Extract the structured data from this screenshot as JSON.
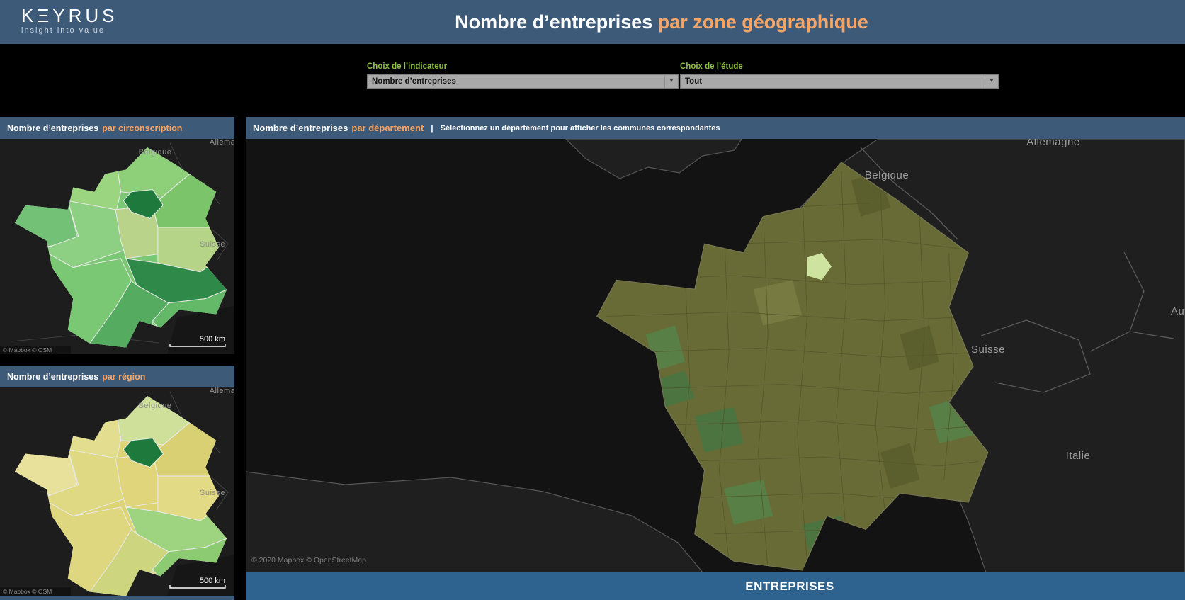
{
  "header": {
    "logo_text": "KΞYRUS",
    "logo_tagline": "insight into value",
    "title_main": "Nombre d’entreprises",
    "title_accent": "par zone géographique"
  },
  "filters": {
    "indicator_label": "Choix de l’indicateur",
    "indicator_value": "Nombre d’entreprises",
    "study_label": "Choix de l’étude",
    "study_value": "Tout",
    "dropdown_caret": "▼"
  },
  "panel_circonscription": {
    "title_main": "Nombre d’entreprises",
    "title_accent": "par circonscription",
    "labels": {
      "belgique": "Belgique",
      "suisse": "Suisse",
      "allemagne": "Allema"
    },
    "scale": "500 km",
    "attribution": "© Mapbox  © OSM"
  },
  "panel_region": {
    "title_main": "Nombre d’entreprises",
    "title_accent": "par région",
    "labels": {
      "belgique": "Belgique",
      "suisse": "Suisse",
      "allemagne": "Allema"
    },
    "scale": "500 km",
    "attribution": "© Mapbox  © OSM"
  },
  "panel_departement": {
    "title_main": "Nombre d’entreprises",
    "title_accent": "par département",
    "separator": "|",
    "subtitle": "Sélectionnez un département pour afficher les communes correspondantes",
    "labels": {
      "belgique": "Belgique",
      "allemagne": "Allemagne",
      "suisse": "Suisse",
      "italie": "Italie",
      "autriche": "Aut"
    },
    "attribution": "© 2020 Mapbox  © OpenStreetMap"
  },
  "footer": {
    "label": "ENTREPRISES"
  },
  "colors": {
    "header_bar": "#3d5a78",
    "accent_orange": "#f7a566",
    "filter_label_green": "#8fbf3f",
    "footer_bar": "#2e6390",
    "map1": {
      "base": "#7ac873",
      "north": "#8ecf7a",
      "normandie": "#9bd57f",
      "grandest": "#7cc46a",
      "bretagne": "#72c176",
      "paysloire": "#8ed083",
      "centre": "#b9d48a",
      "bfc": "#b5d488",
      "na": "#7ac873",
      "aura": "#2f8a4a",
      "occitanie": "#55ab5f",
      "paca": "#63b968",
      "idf": "#1e7a3c"
    },
    "map2": {
      "base": "#ddd476",
      "north": "#cfe09a",
      "normandie": "#e3de8f",
      "grandest": "#d9d074",
      "bretagne": "#e7e19c",
      "paysloire": "#e0d983",
      "centre": "#e0d57a",
      "bfc": "#e3da85",
      "na": "#dfd77f",
      "aura": "#9ed47f",
      "occitanie": "#cdd67f",
      "paca": "#8ccb72",
      "idf": "#1e7a3c"
    },
    "dept": {
      "base": "#686b36",
      "border": "#54562a",
      "outline": "#767652",
      "patch_green": "#4b7440",
      "patch_green2": "#587f46",
      "patch_dark": "#5b5e2d",
      "patch_light": "#787b41",
      "paris": "#cfe3a0"
    }
  }
}
